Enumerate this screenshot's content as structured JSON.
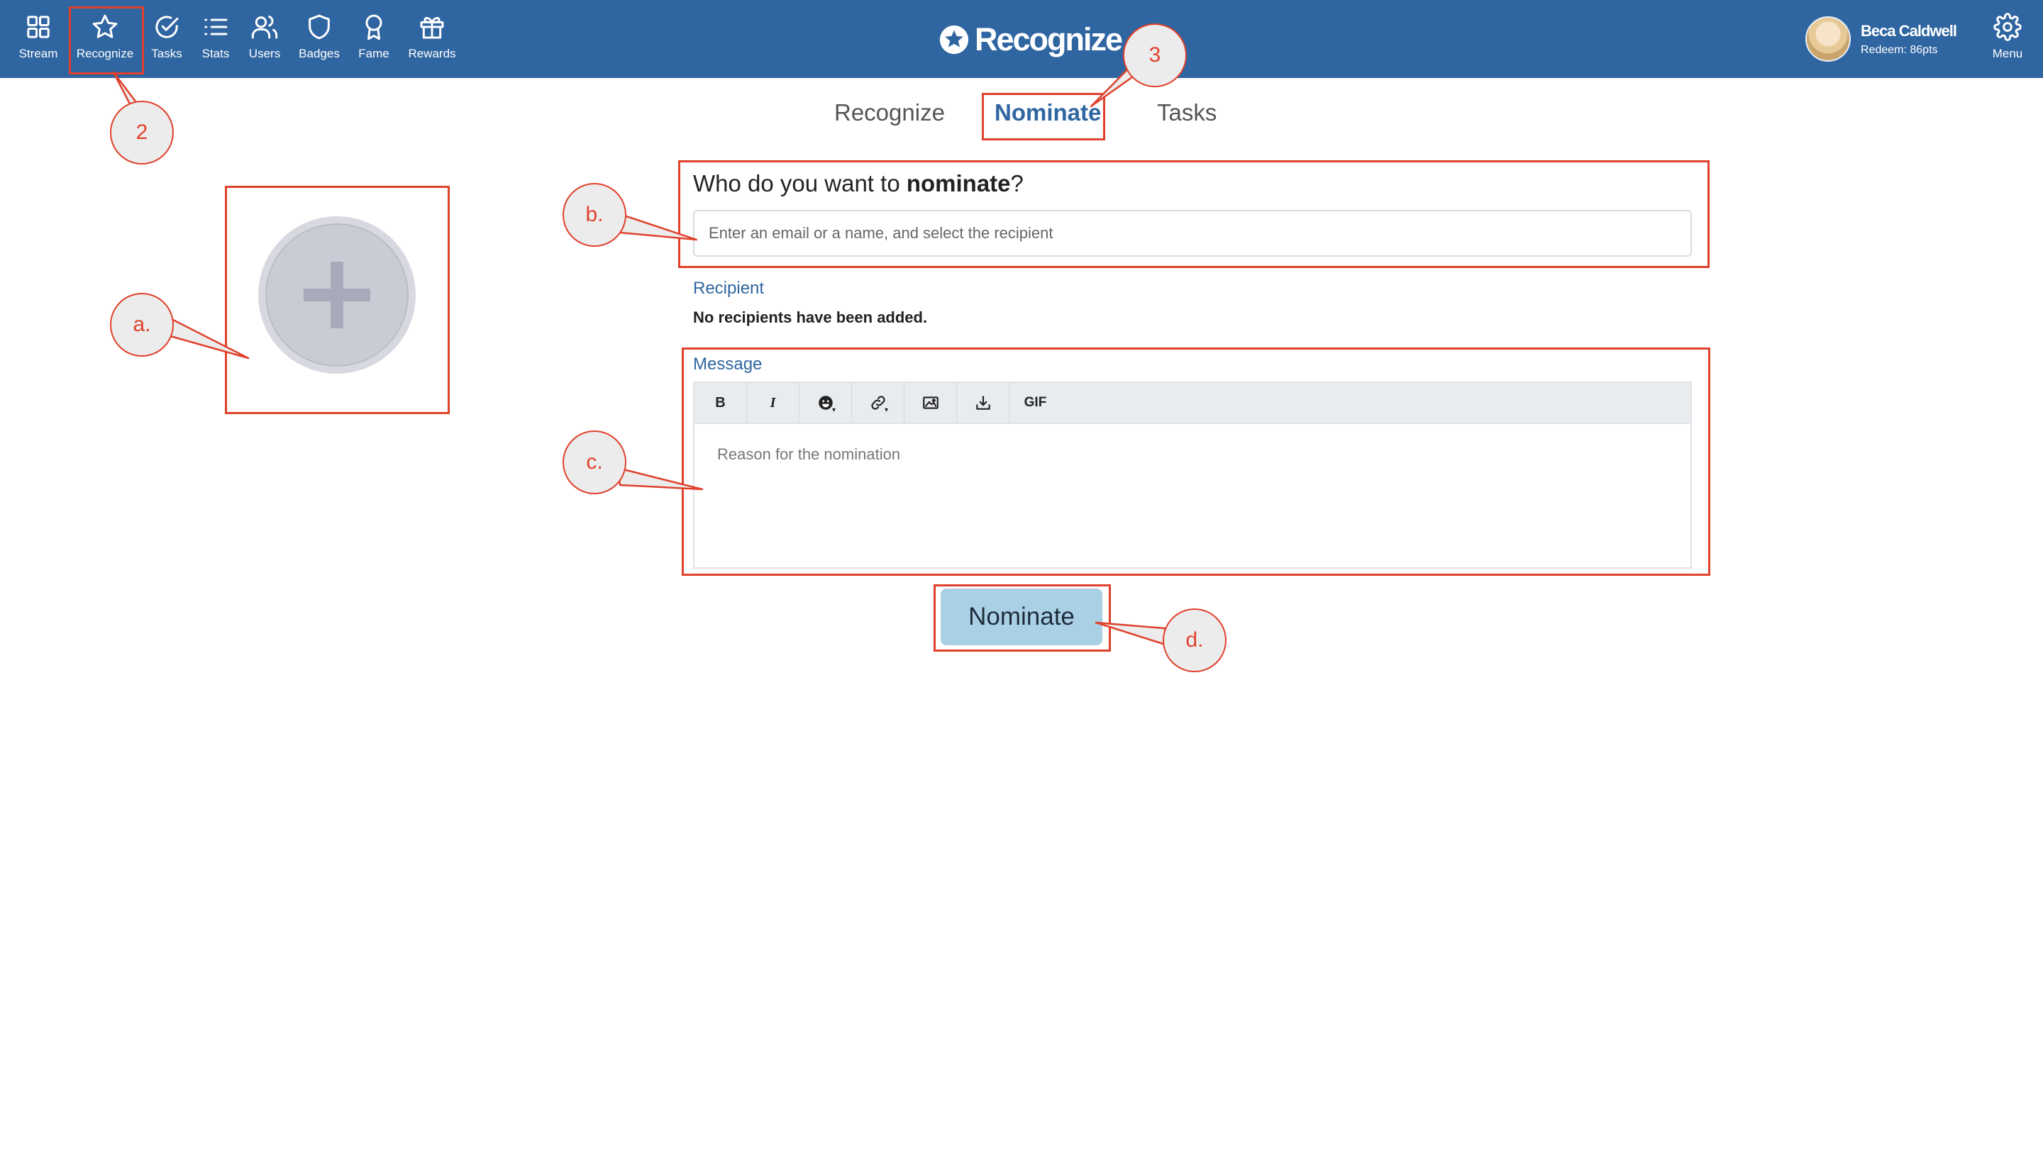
{
  "nav": {
    "items": [
      {
        "label": "Stream",
        "icon": "grid-icon"
      },
      {
        "label": "Recognize",
        "icon": "star-icon"
      },
      {
        "label": "Tasks",
        "icon": "check-circle-icon"
      },
      {
        "label": "Stats",
        "icon": "list-icon"
      },
      {
        "label": "Users",
        "icon": "users-icon"
      },
      {
        "label": "Badges",
        "icon": "shield-icon"
      },
      {
        "label": "Fame",
        "icon": "award-icon"
      },
      {
        "label": "Rewards",
        "icon": "gift-icon"
      }
    ],
    "menu_label": "Menu",
    "background": "#2f65a1"
  },
  "brand": {
    "name": "Recognize"
  },
  "user": {
    "name": "Beca Caldwell",
    "redeem": "Redeem: 86pts"
  },
  "tabs": [
    {
      "label": "Recognize",
      "active": false
    },
    {
      "label": "Nominate",
      "active": true
    },
    {
      "label": "Tasks",
      "active": false
    }
  ],
  "form": {
    "question_prefix": "Who do you want to ",
    "question_bold": "nominate",
    "question_suffix": "?",
    "recipient_placeholder": "Enter an email or a name, and select the recipient",
    "recipient_label": "Recipient",
    "recipient_empty": "No recipients have been added.",
    "message_label": "Message",
    "toolbar": {
      "bold": "B",
      "italic": "I",
      "gif": "GIF"
    },
    "message_placeholder": "Reason for the nomination",
    "submit_label": "Nominate"
  },
  "annotations": {
    "callouts": [
      "2",
      "3",
      "a.",
      "b.",
      "c.",
      "d."
    ],
    "color": "#e0412c"
  }
}
